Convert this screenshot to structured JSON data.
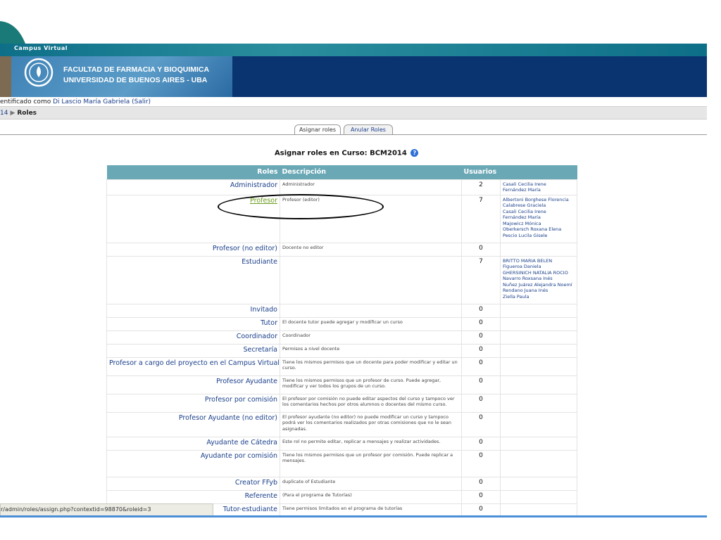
{
  "banner": {
    "label": "Campus Virtual",
    "faculty_line1": "FACULTAD DE FARMACIA Y BIOQUIMICA",
    "faculty_line2": "UNIVERSIDAD DE BUENOS AIRES - UBA"
  },
  "login": {
    "prefix": "entificado como",
    "user": "Di Lascio María Gabriela",
    "logout": "(Salir)"
  },
  "breadcrumb": {
    "course": "14",
    "current": "Roles"
  },
  "tabs": {
    "assign": "Asignar roles",
    "unassign": "Anular Roles"
  },
  "page_title": "Asignar roles en Curso: BCM2014",
  "table": {
    "headers": {
      "roles": "Roles",
      "description": "Descripción",
      "users": "Usuarios"
    },
    "rows": [
      {
        "role": "Administrador",
        "description": "Administrador",
        "count": "2",
        "users": [
          "Casali Cecilia Irene",
          "Fernández María"
        ]
      },
      {
        "role": "Profesor",
        "description": "Profesor (editor)",
        "count": "7",
        "users": [
          "Albertoni Borghese Florencia",
          "Calabrese Graciela",
          "Casali Cecilia Irene",
          "Fernández María",
          "Majowicz Mónica",
          "Oberkersch Roxana Elena",
          "Pescio Lucila Gisele"
        ]
      },
      {
        "role": "Profesor (no editor)",
        "description": "Docente no editor",
        "count": "0",
        "users": []
      },
      {
        "role": "Estudiante",
        "description": "",
        "count": "7",
        "users": [
          "BRITTO MARIA BELEN",
          "Figueroa Daniela",
          "GHERSINICH NATALIA ROCIO",
          "Navarro Roxsana Inés",
          "Nuñez Juárez Alejandra Noemí",
          "Rendano Juana Inés",
          "Ziella Paula"
        ]
      },
      {
        "role": "Invitado",
        "description": "",
        "count": "0",
        "users": []
      },
      {
        "role": "Tutor",
        "description": "El docente tutor puede agregar y modificar un curso",
        "count": "0",
        "users": []
      },
      {
        "role": "Coordinador",
        "description": "Coordinador",
        "count": "0",
        "users": []
      },
      {
        "role": "Secretaría",
        "description": "Permisos a nivel docente",
        "count": "0",
        "users": []
      },
      {
        "role": "Profesor a cargo del proyecto en el Campus Virtual",
        "description": "Tiene los mismos permisos que un docente para poder modificar y editar un curso.",
        "count": "0",
        "users": []
      },
      {
        "role": "Profesor Ayudante",
        "description": "Tiene los mismos permisos que un profesor de curso. Puede agregar, modificar y ver todos los grupos de un curso.",
        "count": "0",
        "users": []
      },
      {
        "role": "Profesor por comisión",
        "description": "El profesor por comisión no puede editar aspectos del curso y tampoco ver los comentarios hechos por otros alumnos o docentes del mismo curso.",
        "count": "0",
        "users": []
      },
      {
        "role": "Profesor Ayudante (no editor)",
        "description": "El profesor ayudante (no editor) no puede modificar un curso y tampoco podrá ver los comentarios realizados por otras comisiones que no le sean asignadas.",
        "count": "0",
        "users": []
      },
      {
        "role": "Ayudante de Cátedra",
        "description": "Este rol no permite editar, replicar a mensajes y realizar actividades.",
        "count": "0",
        "users": []
      },
      {
        "role": "Ayudante por comisión",
        "description": "Tiene los mismos permisos que un profesor por comisión. Puede replicar a mensajes.",
        "count": "0",
        "users": []
      },
      {
        "role": "Creator FFyb",
        "description": "duplicate of Estudiante",
        "count": "0",
        "users": []
      },
      {
        "role": "Referente",
        "description": "(Para el programa de Tutorías)",
        "count": "0",
        "users": []
      },
      {
        "role": "Tutor-estudiante",
        "description": "Tiene permisos limitados en el programa de tutorías",
        "count": "0",
        "users": []
      }
    ]
  },
  "status_bar": "r/admin/roles/assign.php?contextid=98870&roleid=3",
  "colors": {
    "header": "#6aa8b6",
    "banner": "#0a3470",
    "link": "#1a3f8a",
    "highlight_link": "#6a9a1a"
  }
}
